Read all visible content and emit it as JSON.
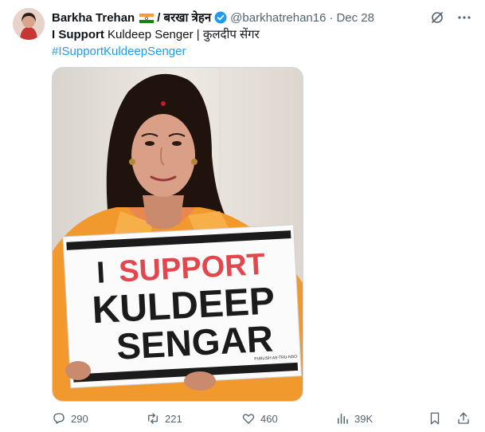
{
  "author": {
    "name": "Barkha Trehan",
    "hindi_name": "/ बरखा त्रेहन",
    "handle": "@barkhatrehan16",
    "separator": "·",
    "date": "Dec 28"
  },
  "tweet": {
    "text_bold": "I Support",
    "text_rest": " Kuldeep Senger | कुलदीप सेंगर",
    "hashtag": "#ISupportKuldeepSenger"
  },
  "media": {
    "sign_line1_i": "I",
    "sign_line1_support": "SUPPORT",
    "sign_line2": "KULDEEP",
    "sign_line3": "SENGAR",
    "sign_tag": "PUBLISH AS-TRU-NDO",
    "colors": {
      "shawl": "#f2992e",
      "sign_red": "#e2474d",
      "sign_black": "#1b1b1b"
    }
  },
  "actions": {
    "replies": "290",
    "reposts": "221",
    "likes": "460",
    "views": "39K"
  }
}
